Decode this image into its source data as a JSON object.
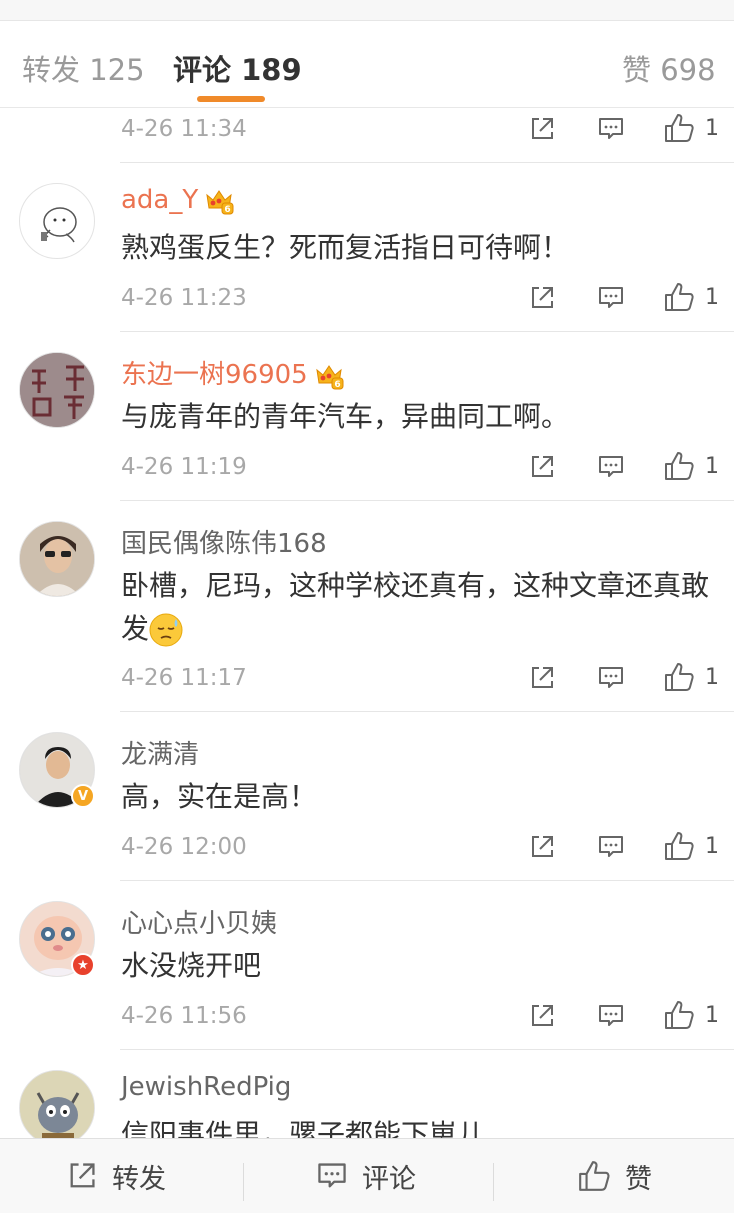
{
  "tabs": [
    {
      "label": "转发",
      "count": "125"
    },
    {
      "label": "评论",
      "count": "189"
    },
    {
      "label": "赞",
      "count": "698"
    }
  ],
  "accent_color": "#f08a2a",
  "name_vip_color": "#eb7350",
  "comments": [
    {
      "time": "4-26 11:34",
      "likes": "1"
    },
    {
      "user": "ada_Y",
      "level": "6",
      "text": "熟鸡蛋反生？死而复活指日可待啊！",
      "time": "4-26 11:23",
      "likes": "1"
    },
    {
      "user": "东边一树96905",
      "level": "6",
      "text": "与庞青年的青年汽车，异曲同工啊。",
      "time": "4-26 11:19",
      "likes": "1"
    },
    {
      "user": "国民偶像陈伟168",
      "text": "卧槽，尼玛，这种学校还真有，这种文章还真敢发",
      "emoji": "sweat-face-icon",
      "time": "4-26 11:17",
      "likes": "1"
    },
    {
      "user": "龙满清",
      "badge": "V",
      "text": "高，实在是高！",
      "time": "4-26 12:00",
      "likes": "1"
    },
    {
      "user": "心心点小贝姨",
      "badge": "★",
      "text": "水没烧开吧",
      "time": "4-26 11:56",
      "likes": "1"
    },
    {
      "user": "JewishRedPig",
      "text": "信阳事件里，骡子都能下崽儿"
    }
  ],
  "footer": {
    "repost": "转发",
    "comment": "评论",
    "like": "赞"
  }
}
